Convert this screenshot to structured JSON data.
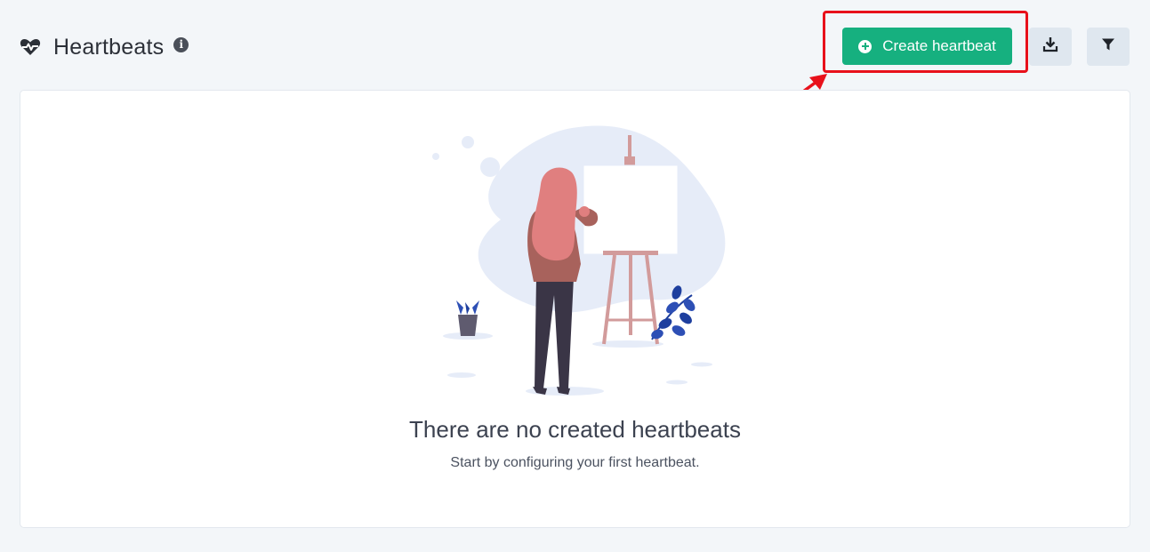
{
  "header": {
    "title": "Heartbeats",
    "title_icon": "heart-pulse-icon",
    "info_icon": "info-icon",
    "info_glyph": "i"
  },
  "toolbar": {
    "create_label": "Create heartbeat",
    "create_icon": "plus-circle-icon",
    "download_icon": "download-icon",
    "filter_icon": "filter-icon"
  },
  "empty_state": {
    "title": "There are no created heartbeats",
    "subtitle": "Start by configuring your first heartbeat."
  },
  "colors": {
    "accent_green": "#16b07f",
    "highlight_red": "#e8111b",
    "background": "#f3f6f9"
  }
}
